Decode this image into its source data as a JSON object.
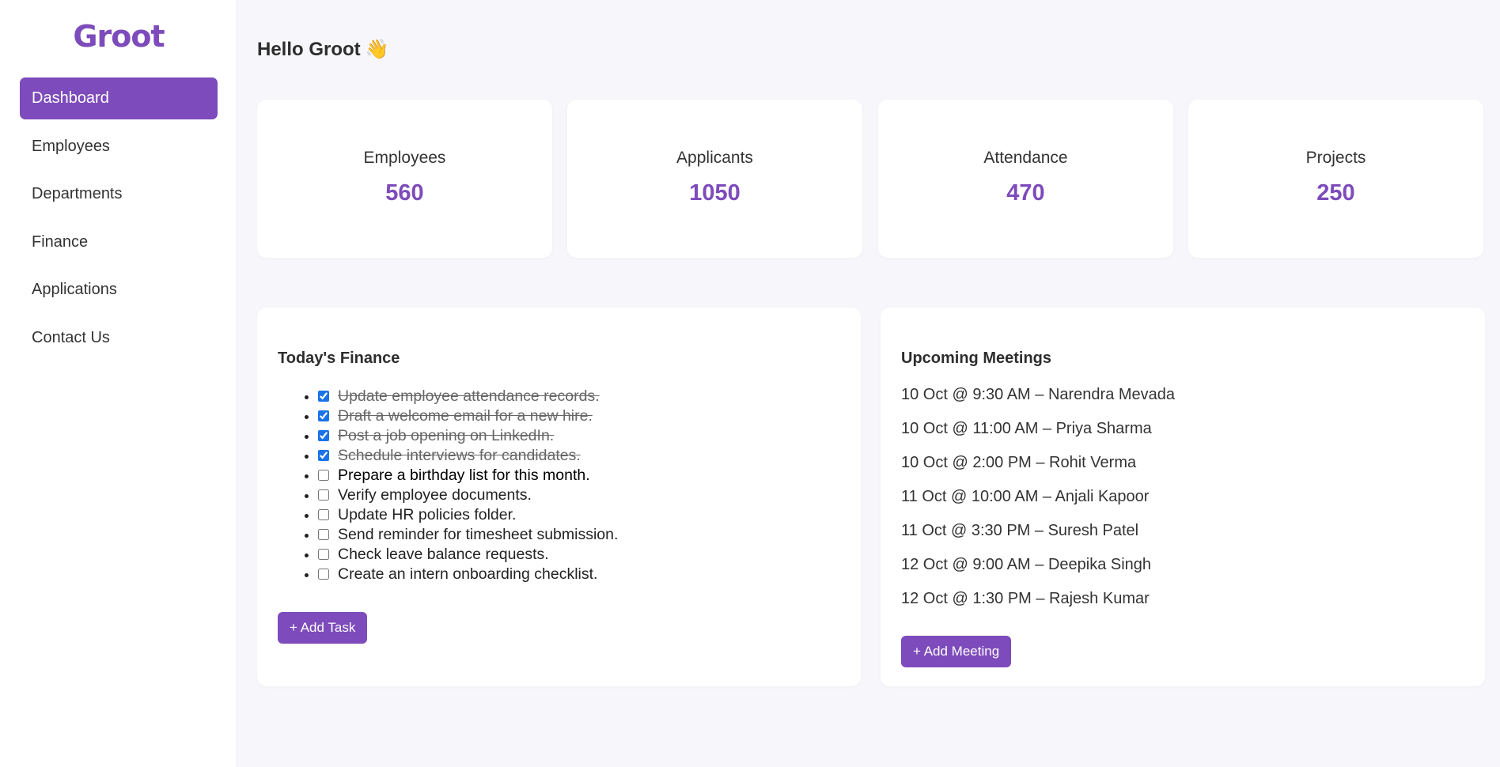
{
  "sidebar": {
    "logo": "Groot",
    "items": [
      {
        "label": "Dashboard",
        "active": true
      },
      {
        "label": "Employees"
      },
      {
        "label": "Departments"
      },
      {
        "label": "Finance"
      },
      {
        "label": "Applications"
      },
      {
        "label": "Contact Us"
      }
    ]
  },
  "header": {
    "greeting": "Hello Groot",
    "emoji": "👋"
  },
  "stats": [
    {
      "label": "Employees",
      "value": "560"
    },
    {
      "label": "Applicants",
      "value": "1050"
    },
    {
      "label": "Attendance",
      "value": "470"
    },
    {
      "label": "Projects",
      "value": "250"
    }
  ],
  "finance": {
    "title": "Today's Finance",
    "tasks": [
      {
        "text": "Update employee attendance records.",
        "done": true
      },
      {
        "text": "Draft a welcome email for a new hire.",
        "done": true
      },
      {
        "text": "Post a job opening on LinkedIn.",
        "done": true
      },
      {
        "text": "Schedule interviews for candidates.",
        "done": true
      },
      {
        "text": "Prepare a birthday list for this month.",
        "done": false
      },
      {
        "text": "Verify employee documents.",
        "done": false
      },
      {
        "text": "Update HR policies folder.",
        "done": false
      },
      {
        "text": "Send reminder for timesheet submission.",
        "done": false
      },
      {
        "text": "Check leave balance requests.",
        "done": false
      },
      {
        "text": "Create an intern onboarding checklist.",
        "done": false
      }
    ],
    "add_button": "+ Add Task"
  },
  "meetings": {
    "title": "Upcoming Meetings",
    "items": [
      "10 Oct @ 9:30 AM – Narendra Mevada",
      "10 Oct @ 11:00 AM – Priya Sharma",
      "10 Oct @ 2:00 PM – Rohit Verma",
      "11 Oct @ 10:00 AM – Anjali Kapoor",
      "11 Oct @ 3:30 PM – Suresh Patel",
      "12 Oct @ 9:00 AM – Deepika Singh",
      "12 Oct @ 1:30 PM – Rajesh Kumar"
    ],
    "add_button": "+ Add Meeting"
  },
  "colors": {
    "accent": "#7d4bbb",
    "background": "#f7f7fb",
    "card": "#ffffff"
  }
}
